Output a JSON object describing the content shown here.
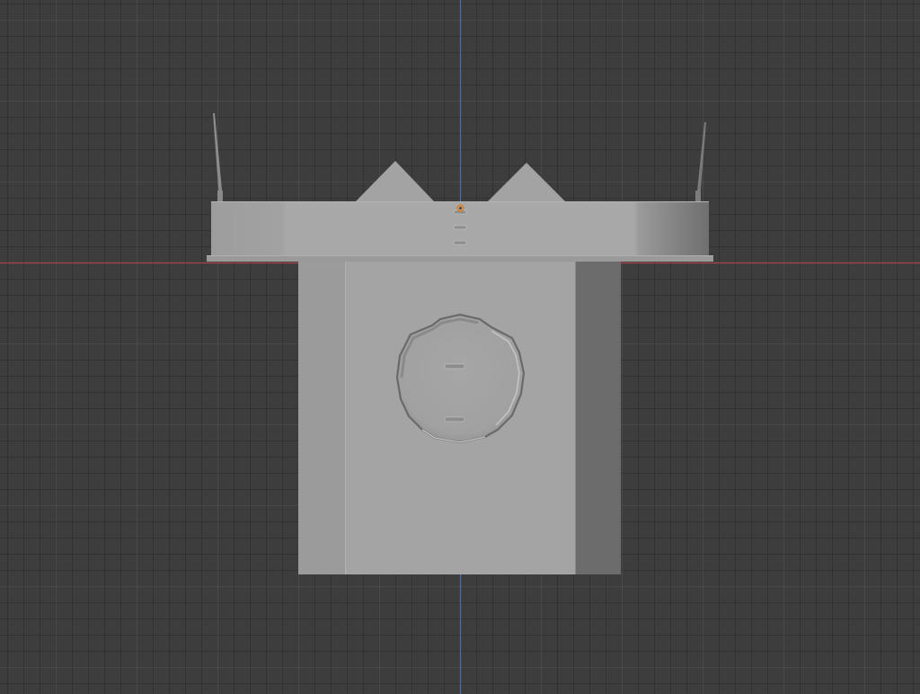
{
  "viewport": {
    "type": "3d-viewport",
    "view": "front-orthographic",
    "colors": {
      "background": "#3d3d3d",
      "x_axis": "#a4444c",
      "z_axis": "#4a6ea8",
      "origin_marker": "#e07b1e",
      "model_light": "#a7a7a7",
      "model_mid": "#999999",
      "model_shadow": "#6a6a6a"
    }
  },
  "object": {
    "name": "",
    "parts": [
      "lid",
      "body",
      "crown-points",
      "antennas",
      "face-recess"
    ]
  },
  "icons": {
    "origin": "origin-point-icon"
  }
}
